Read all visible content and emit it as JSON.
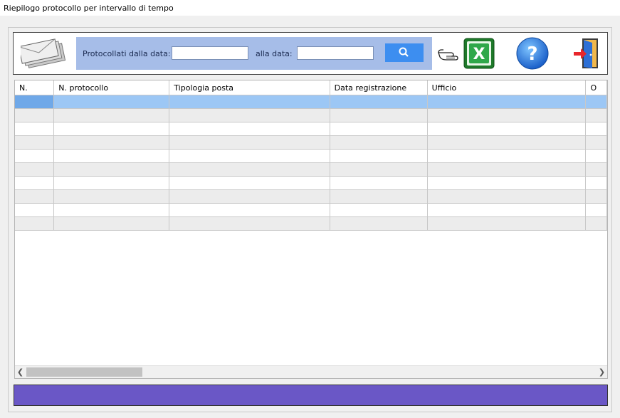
{
  "window": {
    "title": "Riepilogo protocollo per intervallo di tempo"
  },
  "search": {
    "from_label": "Protocollati dalla data:",
    "from_value": "",
    "to_label": "alla data:",
    "to_value": ""
  },
  "toolbar": {
    "icons": [
      "envelopes-icon",
      "search-icon",
      "pointing-hand-icon",
      "excel-icon",
      "help-icon",
      "exit-door-icon"
    ]
  },
  "table": {
    "columns": [
      "N.",
      "N. protocollo",
      "Tipologia posta",
      "Data registrazione",
      "Ufficio",
      "O"
    ],
    "rows": [
      [
        "",
        "",
        "",
        "",
        "",
        ""
      ],
      [
        "",
        "",
        "",
        "",
        "",
        ""
      ],
      [
        "",
        "",
        "",
        "",
        "",
        ""
      ],
      [
        "",
        "",
        "",
        "",
        "",
        ""
      ],
      [
        "",
        "",
        "",
        "",
        "",
        ""
      ],
      [
        "",
        "",
        "",
        "",
        "",
        ""
      ],
      [
        "",
        "",
        "",
        "",
        "",
        ""
      ],
      [
        "",
        "",
        "",
        "",
        "",
        ""
      ],
      [
        "",
        "",
        "",
        "",
        "",
        ""
      ],
      [
        "",
        "",
        "",
        "",
        "",
        ""
      ]
    ],
    "selected_row": 0
  },
  "colors": {
    "search_panel": "#a6bde8",
    "search_button": "#3d8ef0",
    "status_bar": "#6a57c6",
    "selected_row": "#9cc7f5"
  }
}
